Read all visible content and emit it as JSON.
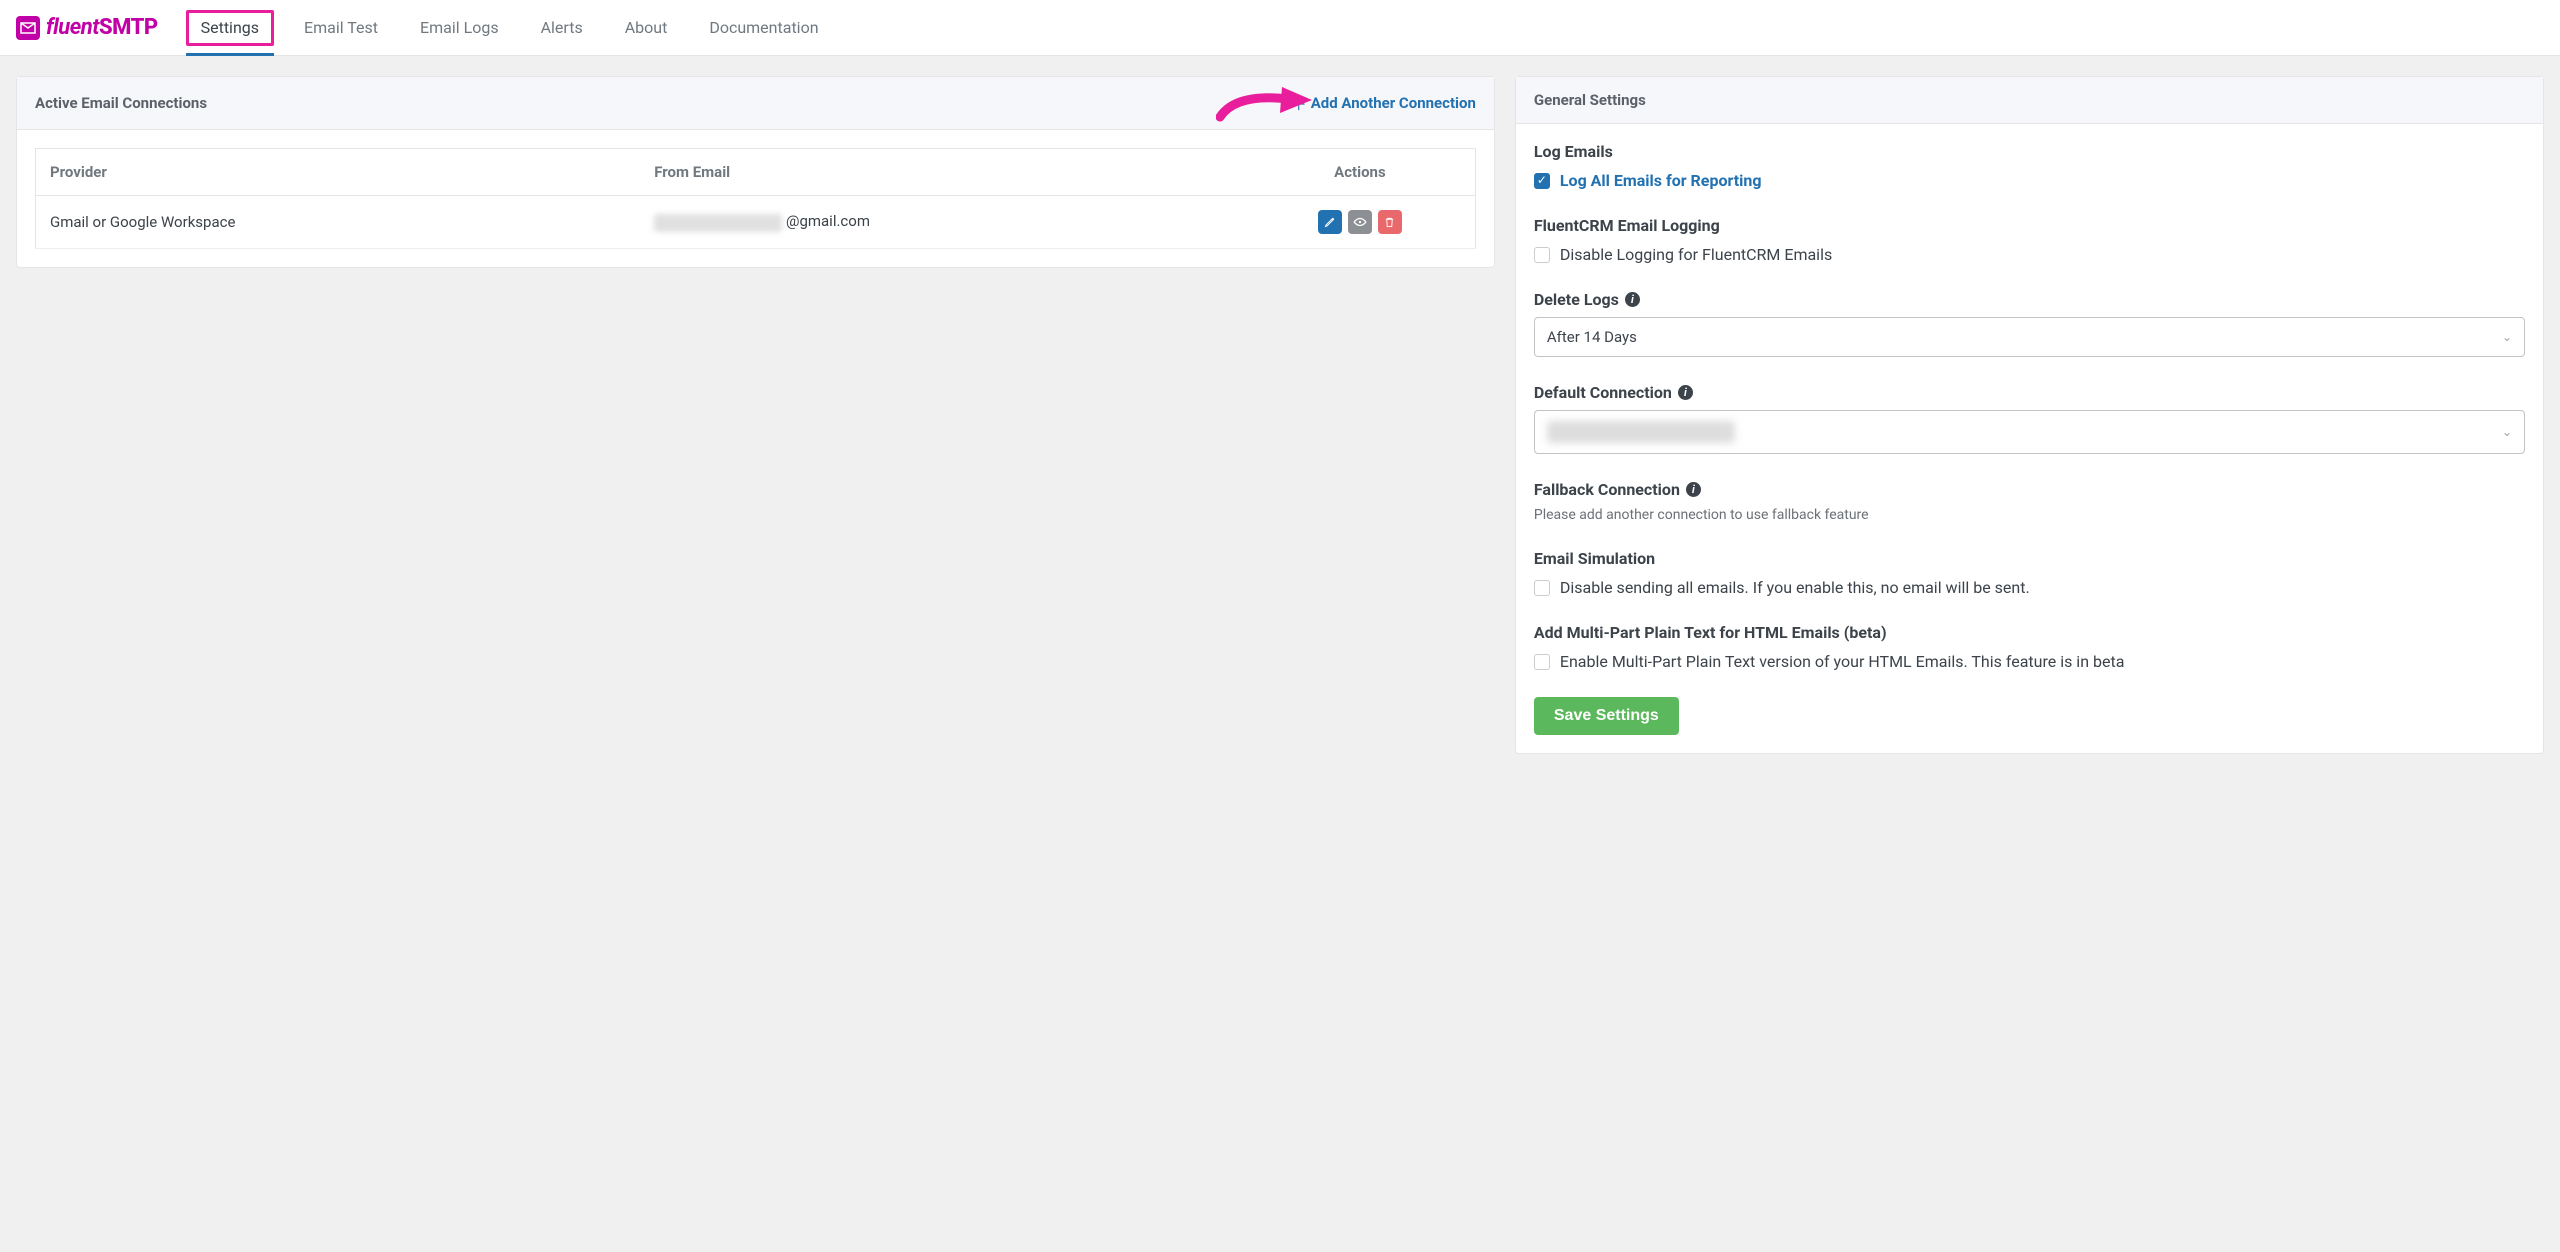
{
  "brand": {
    "name": "fluentSMTP",
    "prefix": "fluent",
    "suffix": "SMTP"
  },
  "nav": {
    "settings": "Settings",
    "email_test": "Email Test",
    "email_logs": "Email Logs",
    "alerts": "Alerts",
    "about": "About",
    "documentation": "Documentation"
  },
  "left": {
    "title": "Active Email Connections",
    "add_link": "Add Another Connection",
    "cols": {
      "provider": "Provider",
      "from": "From Email",
      "actions": "Actions"
    },
    "rows": [
      {
        "provider": "Gmail or Google Workspace",
        "from_suffix": "@gmail.com"
      }
    ]
  },
  "right": {
    "title": "General Settings",
    "log_emails": {
      "title": "Log Emails",
      "checkbox": "Log All Emails for Reporting",
      "checked": true
    },
    "fluentcrm": {
      "title": "FluentCRM Email Logging",
      "checkbox": "Disable Logging for FluentCRM Emails",
      "checked": false
    },
    "delete_logs": {
      "title": "Delete Logs",
      "value": "After 14 Days"
    },
    "default_conn": {
      "title": "Default Connection",
      "value": "Gmail / Google Workspace - example@gmail.com"
    },
    "fallback": {
      "title": "Fallback Connection",
      "helper": "Please add another connection to use fallback feature"
    },
    "simulation": {
      "title": "Email Simulation",
      "checkbox": "Disable sending all emails. If you enable this, no email will be sent.",
      "checked": false
    },
    "multipart": {
      "title": "Add Multi-Part Plain Text for HTML Emails (beta)",
      "checkbox": "Enable Multi-Part Plain Text version of your HTML Emails. This feature is in beta",
      "checked": false
    },
    "save": "Save Settings"
  }
}
